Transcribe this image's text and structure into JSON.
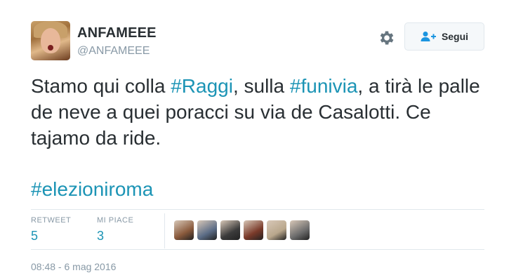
{
  "author": {
    "display_name": "ANFAMEEE",
    "handle": "@ANFAMEEE"
  },
  "follow_button": {
    "label": "Segui"
  },
  "tweet": {
    "segments": [
      {
        "text": "Stamo qui colla ",
        "hashtag": false
      },
      {
        "text": "#Raggi",
        "hashtag": true
      },
      {
        "text": ", sulla ",
        "hashtag": false
      },
      {
        "text": "#funivia",
        "hashtag": true
      },
      {
        "text": ", a tirà le palle de neve a quei poracci su via de Casalotti. Ce tajamo da ride.",
        "hashtag": false
      }
    ],
    "hashtag_line": "#elezioniroma"
  },
  "stats": {
    "retweets": {
      "label": "RETWEET",
      "value": "5"
    },
    "likes": {
      "label": "MI PIACE",
      "value": "3"
    }
  },
  "likers": [
    {
      "name": "liker-1",
      "color": "#8a5a3c"
    },
    {
      "name": "liker-2",
      "color": "#5b6c86"
    },
    {
      "name": "liker-3",
      "color": "#3b3b3b"
    },
    {
      "name": "liker-4",
      "color": "#7a3a2a"
    },
    {
      "name": "liker-5",
      "color": "#b9a78c"
    },
    {
      "name": "liker-6",
      "color": "#6d6d6d"
    }
  ],
  "timestamp": "08:48 - 6 mag 2016",
  "colors": {
    "text": "#292f33",
    "muted": "#8899a6",
    "link": "#1c94b5",
    "border": "#e1e8ed"
  }
}
